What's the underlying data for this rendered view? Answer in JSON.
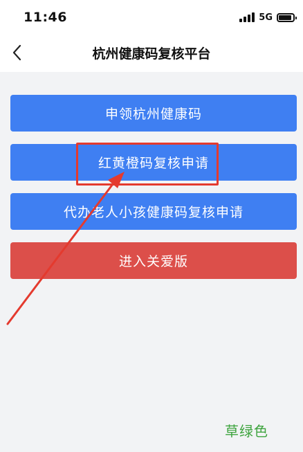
{
  "status_bar": {
    "time": "11:46",
    "network": "5G"
  },
  "header": {
    "title": "杭州健康码复核平台",
    "back_icon": "chevron-left-icon"
  },
  "menu": {
    "items": [
      {
        "label": "申领杭州健康码",
        "color": "#3f7ff2"
      },
      {
        "label": "红黄橙码复核申请",
        "color": "#3f7ff2"
      },
      {
        "label": "代办老人小孩健康码复核申请",
        "color": "#3f7ff2"
      },
      {
        "label": "进入关爱版",
        "color": "#dc4f4a"
      }
    ]
  },
  "annotation": {
    "highlight_color": "#e43a2e",
    "watermark": "草绿色"
  }
}
